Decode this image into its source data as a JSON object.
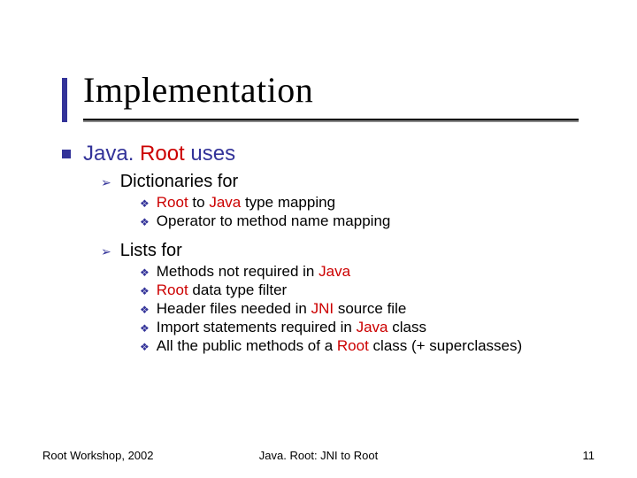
{
  "title": "Implementation",
  "lvl1_prefix": "Java. ",
  "lvl1_hl": "Root",
  "lvl1_suffix": " uses",
  "lvl2a": "Dictionaries for",
  "lvl3a1_hl": "Root",
  "lvl3a1_mid": " to ",
  "lvl3a1_hl2": "Java",
  "lvl3a1_suffix": " type mapping",
  "lvl3a2": "Operator to method name mapping",
  "lvl2b": "Lists for",
  "lvl3b1_prefix": "Methods not required in ",
  "lvl3b1_hl": "Java",
  "lvl3b2_hl": "Root",
  "lvl3b2_suffix": " data type filter",
  "lvl3b3_prefix": "Header files needed in ",
  "lvl3b3_hl": "JNI",
  "lvl3b3_suffix": " source file",
  "lvl3b4_prefix": "Import statements required in ",
  "lvl3b4_hl": "Java",
  "lvl3b4_suffix": " class",
  "lvl3b5_prefix": "All the public methods of a ",
  "lvl3b5_hl": "Root",
  "lvl3b5_suffix": " class (+ superclasses)",
  "footer_left": "Root Workshop, 2002",
  "footer_center": "Java. Root: JNI to Root",
  "footer_right": "11"
}
